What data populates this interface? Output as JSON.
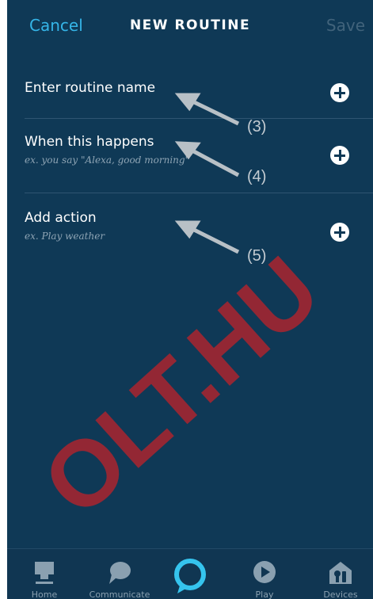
{
  "header": {
    "cancel_label": "Cancel",
    "title": "NEW ROUTINE",
    "save_label": "Save"
  },
  "rows": [
    {
      "title": "Enter routine name",
      "subtitle": ""
    },
    {
      "title": "When this happens",
      "subtitle": "ex. you say \"Alexa, good morning\""
    },
    {
      "title": "Add action",
      "subtitle": "ex. Play weather"
    }
  ],
  "annotations": [
    "(3)",
    "(4)",
    "(5)"
  ],
  "watermark": "OLT.HU",
  "nav": [
    {
      "label": "Home",
      "icon": "home-icon"
    },
    {
      "label": "Communicate",
      "icon": "chat-bubble-icon"
    },
    {
      "label": "",
      "icon": "alexa-ring-icon"
    },
    {
      "label": "Play",
      "icon": "play-icon"
    },
    {
      "label": "Devices",
      "icon": "devices-icon"
    }
  ],
  "colors": {
    "background": "#0f3956",
    "accent": "#35b5e8",
    "watermark": "#ff1a1a"
  }
}
